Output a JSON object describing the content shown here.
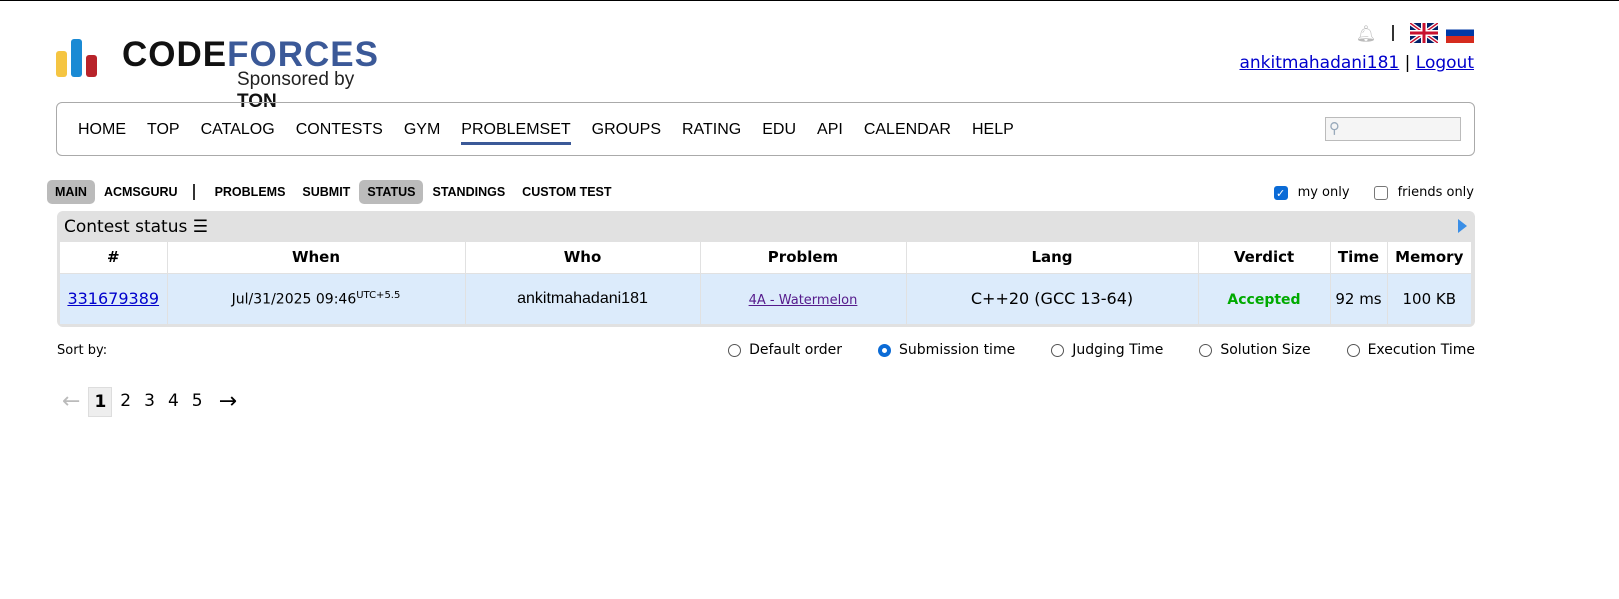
{
  "logo": {
    "word1": "CODE",
    "word2": "FORCES",
    "sponsor_prefix": "Sponsored by ",
    "sponsor_name": "TON"
  },
  "header": {
    "user": "ankitmahadani181",
    "sep": "|",
    "logout": "Logout",
    "langs": [
      "en",
      "ru"
    ]
  },
  "menu": [
    "HOME",
    "TOP",
    "CATALOG",
    "CONTESTS",
    "GYM",
    "PROBLEMSET",
    "GROUPS",
    "RATING",
    "EDU",
    "API",
    "CALENDAR",
    "HELP"
  ],
  "menu_active": "PROBLEMSET",
  "subnav": [
    "MAIN",
    "ACMSGURU",
    "PROBLEMS",
    "SUBMIT",
    "STATUS",
    "STANDINGS",
    "CUSTOM TEST"
  ],
  "filters": {
    "my_only": "my only",
    "friends_only": "friends only"
  },
  "status": {
    "title": "Contest status",
    "columns": [
      "#",
      "When",
      "Who",
      "Problem",
      "Lang",
      "Verdict",
      "Time",
      "Memory"
    ],
    "rows": [
      {
        "id": "331679389",
        "when": "Jul/31/2025 09:46",
        "tz": "UTC+5.5",
        "who": "ankitmahadani181",
        "problem": "4A - Watermelon",
        "lang": "C++20 (GCC 13-64)",
        "verdict": "Accepted",
        "time": "92 ms",
        "memory": "100 KB"
      }
    ]
  },
  "sort": {
    "label": "Sort by:",
    "options": [
      "Default order",
      "Submission time",
      "Judging Time",
      "Solution Size",
      "Execution Time"
    ],
    "selected": 1
  },
  "pager": {
    "prev": "←",
    "pages": [
      "1",
      "2",
      "3",
      "4",
      "5"
    ],
    "current": "1",
    "next": "→"
  }
}
